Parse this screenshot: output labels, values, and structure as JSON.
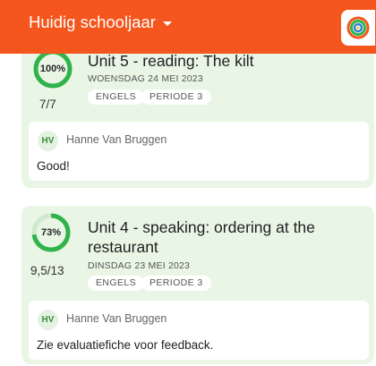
{
  "header": {
    "title": "Huidig schooljaar",
    "brand_color": "#f4561d",
    "dropdown_icon": "caret-down-icon",
    "logo_icon": "app-logo-icon"
  },
  "evaluations": [
    {
      "percent_label": "100%",
      "percent_value": 100,
      "score": "7/7",
      "title": "Unit 5 - reading: The kilt",
      "date": "WOENSDAG 24 MEI 2023",
      "tags": [
        "ENGELS",
        "PERIODE 3"
      ],
      "comment": {
        "initials": "HV",
        "author": "Hanne Van Bruggen",
        "text": "Good!"
      }
    },
    {
      "percent_label": "73%",
      "percent_value": 73,
      "score": "9,5/13",
      "title_line1": "Unit 4 - speaking: ordering at the",
      "title_line2": "restaurant",
      "date": "DINSDAG 23 MEI 2023",
      "tags": [
        "ENGELS",
        "PERIODE 3"
      ],
      "comment": {
        "initials": "HV",
        "author": "Hanne Van Bruggen",
        "text": "Zie evaluatiefiche voor feedback."
      }
    }
  ],
  "colors": {
    "card_bg": "#e9f6e6",
    "ring_green": "#2fb34a",
    "ring_track": "#cfe9cc"
  }
}
